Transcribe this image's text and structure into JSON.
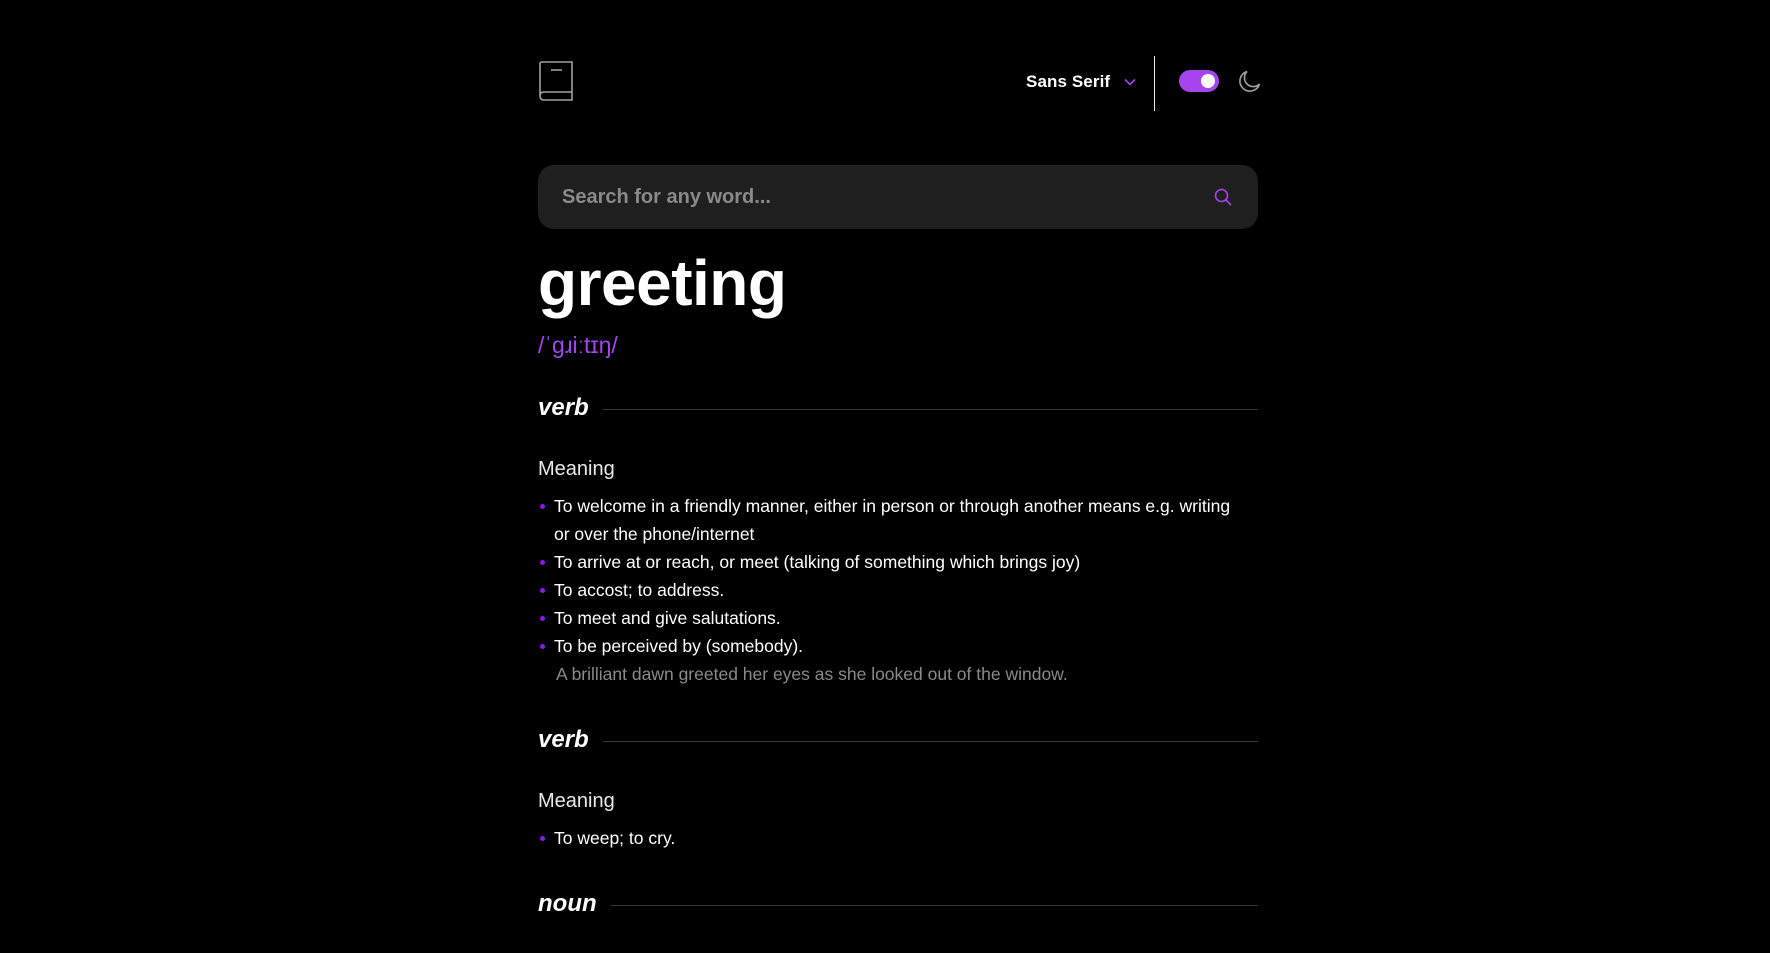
{
  "header": {
    "font_selected": "Sans Serif",
    "theme_toggle_state": "on",
    "icons": [
      "book-logo-icon",
      "chevron-down-icon",
      "moon-icon"
    ]
  },
  "search": {
    "placeholder": "Search for any word...",
    "value": "",
    "icon": "search-icon"
  },
  "entry": {
    "word": "greeting",
    "phonetic": "/ˈɡɹiːtɪŋ/",
    "meanings": [
      {
        "part_of_speech": "verb",
        "heading": "Meaning",
        "definitions": [
          {
            "text": "To welcome in a friendly manner, either in person or through another means e.g. writing or over the phone/internet"
          },
          {
            "text": "To arrive at or reach, or meet (talking of something which brings joy)"
          },
          {
            "text": "To accost; to address."
          },
          {
            "text": "To meet and give salutations."
          },
          {
            "text": "To be perceived by (somebody).",
            "example": "A brilliant dawn greeted her eyes as she looked out of the window."
          }
        ]
      },
      {
        "part_of_speech": "verb",
        "heading": "Meaning",
        "definitions": [
          {
            "text": "To weep; to cry."
          }
        ]
      },
      {
        "part_of_speech": "noun"
      }
    ]
  },
  "colors": {
    "background": "#000000",
    "accent": "#a445ed",
    "search_bg": "#1f1f1f",
    "muted_text": "#8a8a8a",
    "rule": "#3a3a3a"
  }
}
